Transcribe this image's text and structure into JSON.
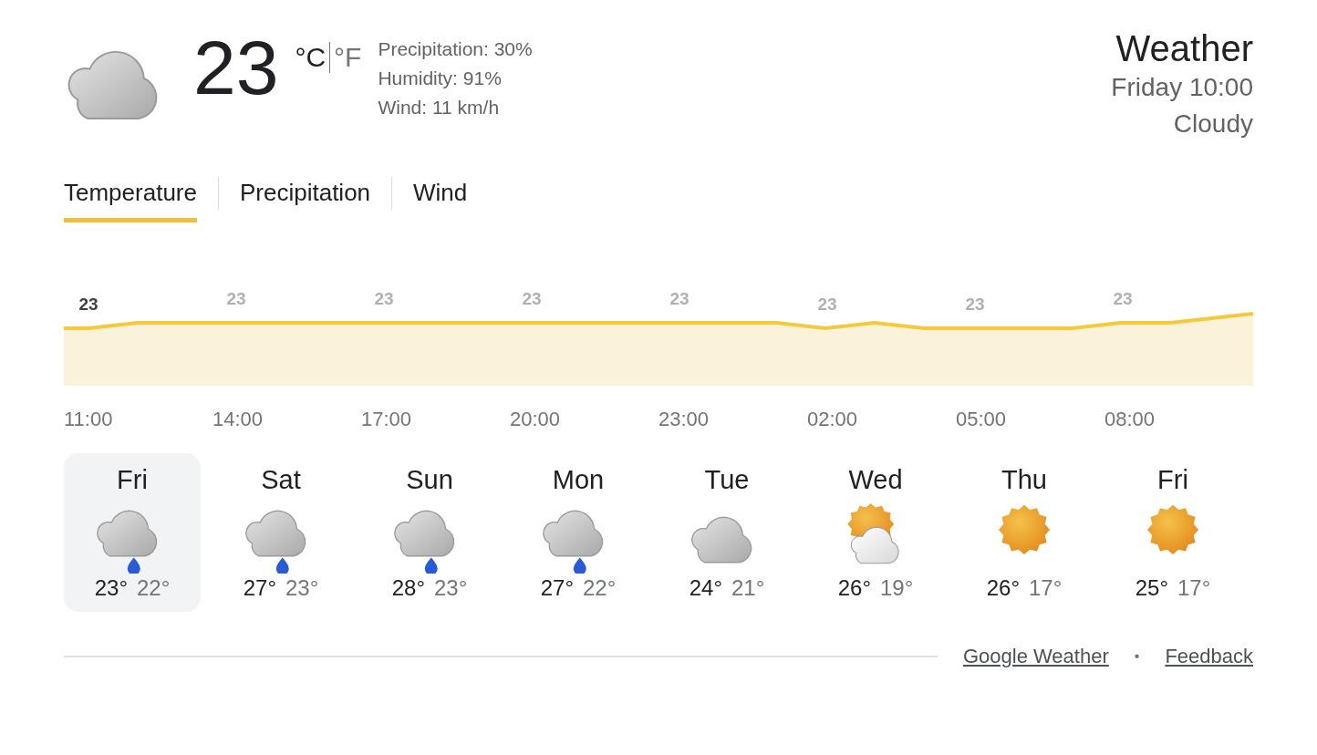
{
  "current": {
    "kind": "cloudy",
    "temperature": "23",
    "units": [
      {
        "label": "°C",
        "selected": true
      },
      {
        "label": "°F",
        "selected": false
      }
    ],
    "details": [
      "Precipitation: 30%",
      "Humidity: 91%",
      "Wind: 11 km/h"
    ]
  },
  "header": {
    "title": "Weather",
    "time": "Friday 10:00",
    "condition": "Cloudy"
  },
  "tabs": [
    {
      "label": "Temperature",
      "selected": true
    },
    {
      "label": "Precipitation",
      "selected": false
    },
    {
      "label": "Wind",
      "selected": false
    }
  ],
  "temperature_chart": {
    "point_labels": [
      {
        "text": "23",
        "selected": true
      },
      {
        "text": "23",
        "selected": false
      },
      {
        "text": "23",
        "selected": false
      },
      {
        "text": "23",
        "selected": false
      },
      {
        "text": "23",
        "selected": false
      },
      {
        "text": "23",
        "selected": false
      },
      {
        "text": "23",
        "selected": false
      },
      {
        "text": "23",
        "selected": false
      }
    ],
    "hours": [
      "11:00",
      "14:00",
      "17:00",
      "20:00",
      "23:00",
      "02:00",
      "05:00",
      "08:00"
    ]
  },
  "days": [
    {
      "day": "Fri",
      "kind": "rain",
      "high": "23°",
      "low": "22°",
      "selected": true
    },
    {
      "day": "Sat",
      "kind": "rain",
      "high": "27°",
      "low": "23°",
      "selected": false
    },
    {
      "day": "Sun",
      "kind": "rain",
      "high": "28°",
      "low": "23°",
      "selected": false
    },
    {
      "day": "Mon",
      "kind": "rain",
      "high": "27°",
      "low": "22°",
      "selected": false
    },
    {
      "day": "Tue",
      "kind": "cloudy",
      "high": "24°",
      "low": "21°",
      "selected": false
    },
    {
      "day": "Wed",
      "kind": "partly_sunny",
      "high": "26°",
      "low": "19°",
      "selected": false
    },
    {
      "day": "Thu",
      "kind": "sunny",
      "high": "26°",
      "low": "17°",
      "selected": false
    },
    {
      "day": "Fri",
      "kind": "sunny",
      "high": "25°",
      "low": "17°",
      "selected": false
    }
  ],
  "footer": {
    "links": [
      "Google Weather",
      "Feedback"
    ],
    "separator": "•"
  }
}
